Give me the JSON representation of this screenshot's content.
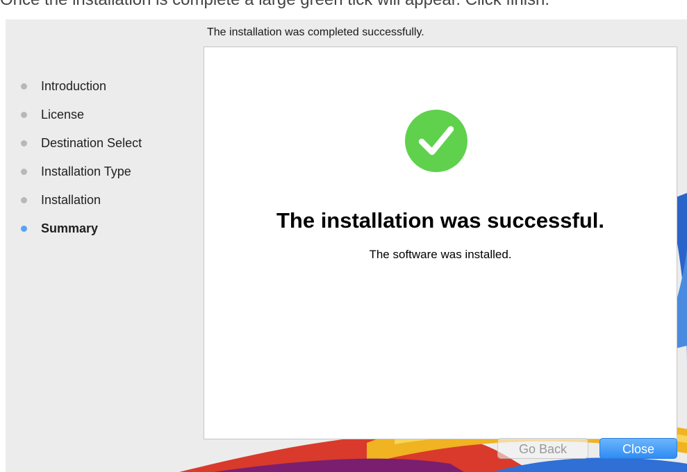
{
  "caption": "Once the installation is complete a large green tick will appear. Click finish.",
  "header": {
    "status_text": "The installation was completed successfully."
  },
  "sidebar": {
    "steps": [
      {
        "label": "Introduction",
        "current": false
      },
      {
        "label": "License",
        "current": false
      },
      {
        "label": "Destination Select",
        "current": false
      },
      {
        "label": "Installation Type",
        "current": false
      },
      {
        "label": "Installation",
        "current": false
      },
      {
        "label": "Summary",
        "current": true
      }
    ]
  },
  "main": {
    "icon": "check-circle-icon",
    "title": "The installation was successful.",
    "subtitle": "The software was installed."
  },
  "buttons": {
    "back_label": "Go Back",
    "back_enabled": false,
    "close_label": "Close"
  },
  "colors": {
    "accent": "#3b95f6",
    "success_green": "#5fd14d",
    "current_step_dot": "#59a3f2",
    "inactive_step_dot": "#b8b8b8"
  }
}
